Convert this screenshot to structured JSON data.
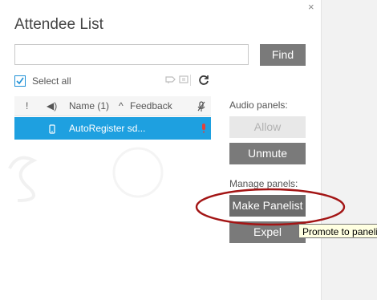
{
  "dialog": {
    "title": "Attendee List",
    "close_label": "×"
  },
  "search": {
    "value": "",
    "placeholder": "",
    "find_label": "Find"
  },
  "select_all": {
    "label": "Select all",
    "checked": true
  },
  "table": {
    "headers": {
      "raise_hand": "!",
      "audio": "◀)",
      "name": "Name (1)",
      "sort_indicator": "^",
      "feedback": "Feedback"
    },
    "rows": [
      {
        "name": "AutoRegister sd...",
        "selected": true,
        "device_icon": "phone-icon",
        "mic_status": "mic-off-icon"
      }
    ]
  },
  "audio_panels": {
    "label": "Audio panels:",
    "allow_label": "Allow",
    "unmute_label": "Unmute"
  },
  "manage_panels": {
    "label": "Manage panels:",
    "make_panelist_label": "Make Panelist",
    "expel_label": "Expel"
  },
  "tooltip": {
    "text": "Promote to panelist"
  },
  "colors": {
    "accent": "#1ea0e0",
    "button_gray": "#7a7a7a",
    "highlight_oval": "#a31515",
    "tooltip_bg": "#ffffe1"
  }
}
